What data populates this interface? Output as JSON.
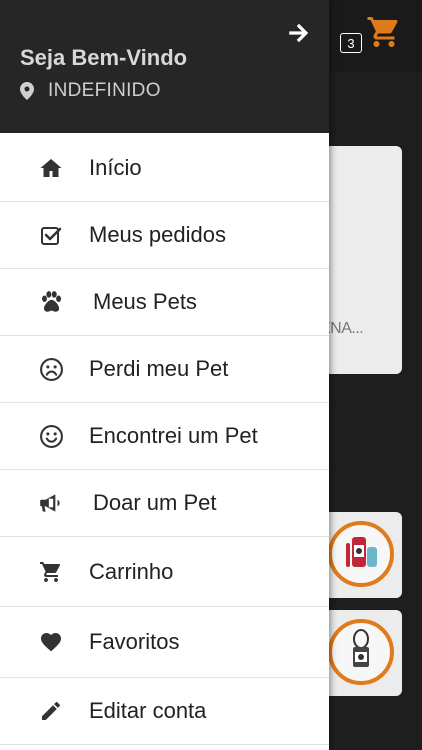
{
  "header": {
    "welcome": "Seja Bem-Vindo",
    "location": "INDEFINIDO"
  },
  "cart": {
    "count": "3"
  },
  "background": {
    "truncated_text": "ENA..."
  },
  "menu": {
    "items": [
      {
        "label": "Início",
        "icon": "home-icon"
      },
      {
        "label": "Meus pedidos",
        "icon": "checkbox-icon"
      },
      {
        "label": "Meus Pets",
        "icon": "paw-icon"
      },
      {
        "label": "Perdi meu Pet",
        "icon": "sad-face-icon"
      },
      {
        "label": "Encontrei um Pet",
        "icon": "smile-face-icon"
      },
      {
        "label": "Doar um Pet",
        "icon": "megaphone-icon"
      },
      {
        "label": "Carrinho",
        "icon": "cart-icon"
      },
      {
        "label": "Favoritos",
        "icon": "heart-icon"
      },
      {
        "label": "Editar conta",
        "icon": "pencil-icon"
      }
    ]
  },
  "colors": {
    "accent": "#e07b1b",
    "header_bg": "#262626"
  }
}
